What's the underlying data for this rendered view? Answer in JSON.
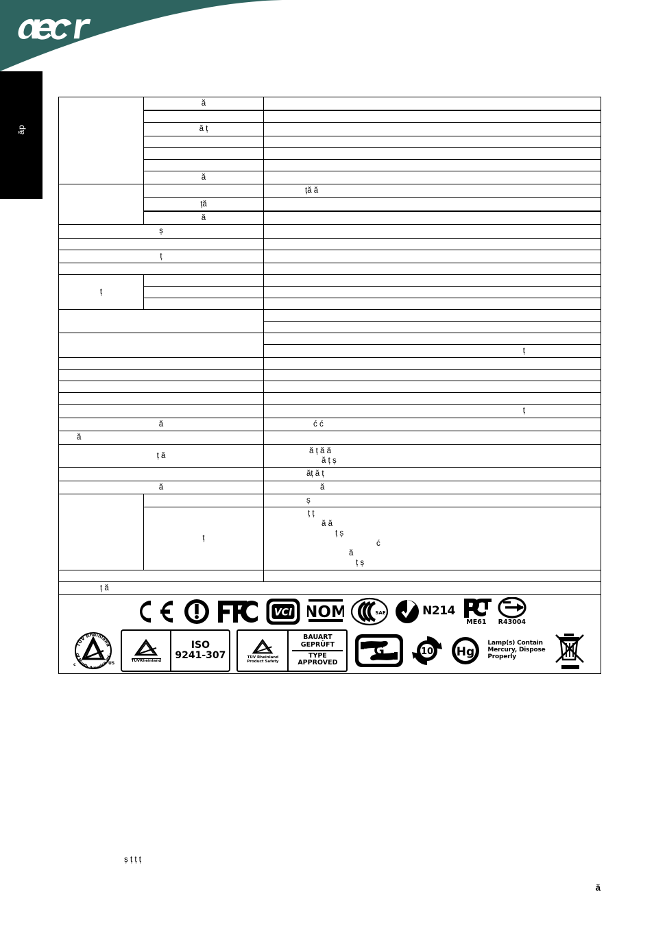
{
  "document": {
    "brand": "acer",
    "brand_color": "#2e6460",
    "page_type": "monitor-specification-sheet",
    "side_tab_label": "ăp"
  },
  "spec_table": {
    "rows": [
      {
        "id": "r1",
        "group": "",
        "sub": "ă",
        "value": "",
        "cells": 3,
        "thick_bottom": true,
        "height": "normal"
      },
      {
        "id": "r2",
        "group": "",
        "sub": "",
        "value": "",
        "cells": 3,
        "thick_bottom": false,
        "height": "normal"
      },
      {
        "id": "r3",
        "group": "",
        "sub": "ă ț",
        "value": "",
        "cells": 3,
        "thick_bottom": false,
        "height": "normal"
      },
      {
        "id": "r4",
        "group": "",
        "sub": "",
        "value": "",
        "cells": 3,
        "thick_bottom": false,
        "height": "normal"
      },
      {
        "id": "r5",
        "group": "",
        "sub": "",
        "value": "",
        "cells": 3,
        "thick_bottom": false,
        "height": "normal"
      },
      {
        "id": "r6",
        "group": "",
        "sub": "",
        "value": "",
        "cells": 3,
        "thick_bottom": false,
        "height": "normal"
      },
      {
        "id": "r7",
        "group": "",
        "sub": "ă",
        "value": "",
        "cells": 3,
        "thick_bottom": false,
        "height": "normal"
      },
      {
        "id": "r8",
        "group": "",
        "sub": "",
        "value": "ță        ă",
        "cells": 3,
        "thick_bottom": false,
        "height": "normal"
      },
      {
        "id": "r9",
        "group": "",
        "sub": "ță",
        "value": "",
        "cells": 3,
        "thick_bottom": true,
        "height": "normal"
      },
      {
        "id": "r10",
        "group": "",
        "sub": "ă",
        "value": "",
        "cells": 3,
        "thick_bottom": false,
        "height": "normal"
      }
    ],
    "rows_wide": [
      {
        "id": "r11",
        "label": "ș",
        "value": ""
      },
      {
        "id": "r12",
        "label": "",
        "value": ""
      },
      {
        "id": "r13",
        "label": "ț",
        "value": ""
      },
      {
        "id": "r14",
        "label": "",
        "value": ""
      }
    ],
    "rows_split": [
      {
        "id": "r15",
        "group": "ț",
        "sub": "",
        "value": ""
      },
      {
        "id": "r16",
        "group": "",
        "sub": "",
        "value": ""
      },
      {
        "id": "r17",
        "group": "",
        "sub": "",
        "value": ""
      }
    ],
    "rows_pair": [
      {
        "id": "r18",
        "label": "",
        "value": ""
      },
      {
        "id": "r19",
        "label": "",
        "value": ""
      },
      {
        "id": "r20",
        "label": "",
        "value": ""
      },
      {
        "id": "r21",
        "label": "",
        "value": "ț"
      },
      {
        "id": "r22",
        "label": "",
        "value": ""
      },
      {
        "id": "r23",
        "label": "",
        "value": ""
      },
      {
        "id": "r24",
        "label": "",
        "value": ""
      },
      {
        "id": "r25",
        "label": "",
        "value": ""
      },
      {
        "id": "r26",
        "label": "",
        "value": "ț"
      },
      {
        "id": "r27",
        "label": "ă",
        "value": "ć            ć"
      },
      {
        "id": "r28",
        "label": "ă",
        "value": ""
      },
      {
        "id": "r29",
        "label": "ț                         ă",
        "value_line1": "ă        ț             ă                    ă",
        "value_line2": "ă                        ț                ș"
      },
      {
        "id": "r30",
        "label": "",
        "value": "ăț           ă ț"
      },
      {
        "id": "r31",
        "label": "ă",
        "value": "ă"
      }
    ],
    "rows_bottom_split": [
      {
        "id": "r32",
        "group": "",
        "sub": "",
        "value": "ș"
      },
      {
        "id": "r33",
        "group": "",
        "sub": "ț",
        "value_lines": [
          "ț                                                  ț",
          "ă                                        ă",
          "ț     ș",
          "ć",
          "ă",
          "ț          ș"
        ]
      }
    ],
    "rows_tail": [
      {
        "id": "r34",
        "label": "",
        "value": ""
      },
      {
        "id": "r35",
        "label": "ț      ă",
        "value": ""
      }
    ]
  },
  "certifications": {
    "row1": [
      {
        "name": "ce-mark",
        "label": "CE"
      },
      {
        "name": "ce-alert-mark",
        "label": "!"
      },
      {
        "name": "fcc-mark",
        "label": "FC"
      },
      {
        "name": "vcci-mark",
        "label": "VCI"
      },
      {
        "name": "nom-mark",
        "label": "NOM"
      },
      {
        "name": "ccc-mark",
        "label": "CCC",
        "sub": "SAE"
      },
      {
        "name": "c-tick-mark",
        "label": "N214"
      },
      {
        "name": "pct-mark",
        "label": "ME61"
      },
      {
        "name": "e-mark",
        "label": "R43004"
      }
    ],
    "row2": [
      {
        "name": "tuv-rheinland-na-mark",
        "top": "TÜV Rheinland",
        "bottom": "of North America Inc.",
        "left": "c",
        "right": "US"
      },
      {
        "name": "tuv-iso-mark",
        "pane1": "TÜVRheinland",
        "pane2_line1": "ISO",
        "pane2_line2": "9241-307"
      },
      {
        "name": "tuv-bauart-mark",
        "pane1": "TÜV Rheinland Product Safety",
        "pane2_line1": "BAUART",
        "pane2_line2": "GEPRÜFT",
        "pane2_line3": "TYPE",
        "pane2_line4": "APPROVED"
      },
      {
        "name": "gs-hands-mark",
        "label": "G"
      },
      {
        "name": "rohs-10-mark",
        "label": "10"
      },
      {
        "name": "mercury-hg-mark",
        "label": "Hg"
      },
      {
        "name": "mercury-text",
        "line1": "Lamp(s) Contain",
        "line2": "Mercury, Dispose",
        "line3": "Properly"
      },
      {
        "name": "weee-bin-mark",
        "label": ""
      }
    ]
  },
  "footer": {
    "note_line1": "ș       ț                            ț    ț",
    "note_line2": "",
    "page_marker": "ă"
  }
}
